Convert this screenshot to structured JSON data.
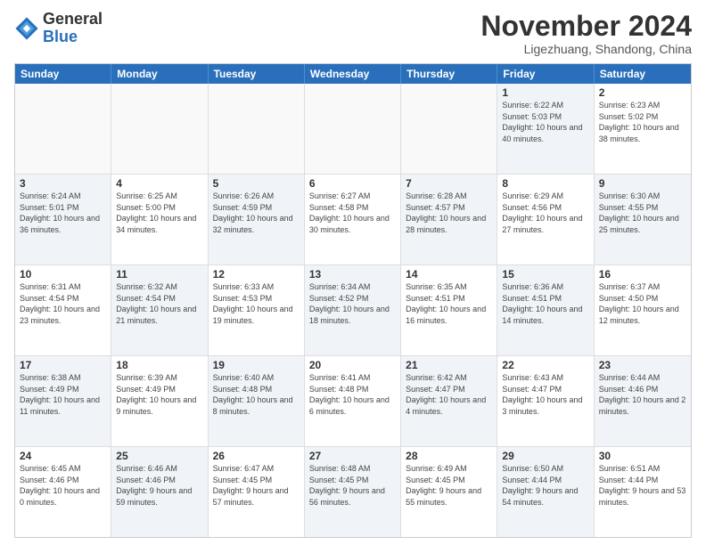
{
  "logo": {
    "general": "General",
    "blue": "Blue"
  },
  "title": "November 2024",
  "location": "Ligezhuang, Shandong, China",
  "headers": [
    "Sunday",
    "Monday",
    "Tuesday",
    "Wednesday",
    "Thursday",
    "Friday",
    "Saturday"
  ],
  "rows": [
    [
      {
        "num": "",
        "info": "",
        "empty": true
      },
      {
        "num": "",
        "info": "",
        "empty": true
      },
      {
        "num": "",
        "info": "",
        "empty": true
      },
      {
        "num": "",
        "info": "",
        "empty": true
      },
      {
        "num": "",
        "info": "",
        "empty": true
      },
      {
        "num": "1",
        "info": "Sunrise: 6:22 AM\nSunset: 5:03 PM\nDaylight: 10 hours and 40 minutes.",
        "shaded": true
      },
      {
        "num": "2",
        "info": "Sunrise: 6:23 AM\nSunset: 5:02 PM\nDaylight: 10 hours and 38 minutes.",
        "shaded": false
      }
    ],
    [
      {
        "num": "3",
        "info": "Sunrise: 6:24 AM\nSunset: 5:01 PM\nDaylight: 10 hours and 36 minutes.",
        "shaded": true
      },
      {
        "num": "4",
        "info": "Sunrise: 6:25 AM\nSunset: 5:00 PM\nDaylight: 10 hours and 34 minutes.",
        "shaded": false
      },
      {
        "num": "5",
        "info": "Sunrise: 6:26 AM\nSunset: 4:59 PM\nDaylight: 10 hours and 32 minutes.",
        "shaded": true
      },
      {
        "num": "6",
        "info": "Sunrise: 6:27 AM\nSunset: 4:58 PM\nDaylight: 10 hours and 30 minutes.",
        "shaded": false
      },
      {
        "num": "7",
        "info": "Sunrise: 6:28 AM\nSunset: 4:57 PM\nDaylight: 10 hours and 28 minutes.",
        "shaded": true
      },
      {
        "num": "8",
        "info": "Sunrise: 6:29 AM\nSunset: 4:56 PM\nDaylight: 10 hours and 27 minutes.",
        "shaded": false
      },
      {
        "num": "9",
        "info": "Sunrise: 6:30 AM\nSunset: 4:55 PM\nDaylight: 10 hours and 25 minutes.",
        "shaded": true
      }
    ],
    [
      {
        "num": "10",
        "info": "Sunrise: 6:31 AM\nSunset: 4:54 PM\nDaylight: 10 hours and 23 minutes.",
        "shaded": false
      },
      {
        "num": "11",
        "info": "Sunrise: 6:32 AM\nSunset: 4:54 PM\nDaylight: 10 hours and 21 minutes.",
        "shaded": true
      },
      {
        "num": "12",
        "info": "Sunrise: 6:33 AM\nSunset: 4:53 PM\nDaylight: 10 hours and 19 minutes.",
        "shaded": false
      },
      {
        "num": "13",
        "info": "Sunrise: 6:34 AM\nSunset: 4:52 PM\nDaylight: 10 hours and 18 minutes.",
        "shaded": true
      },
      {
        "num": "14",
        "info": "Sunrise: 6:35 AM\nSunset: 4:51 PM\nDaylight: 10 hours and 16 minutes.",
        "shaded": false
      },
      {
        "num": "15",
        "info": "Sunrise: 6:36 AM\nSunset: 4:51 PM\nDaylight: 10 hours and 14 minutes.",
        "shaded": true
      },
      {
        "num": "16",
        "info": "Sunrise: 6:37 AM\nSunset: 4:50 PM\nDaylight: 10 hours and 12 minutes.",
        "shaded": false
      }
    ],
    [
      {
        "num": "17",
        "info": "Sunrise: 6:38 AM\nSunset: 4:49 PM\nDaylight: 10 hours and 11 minutes.",
        "shaded": true
      },
      {
        "num": "18",
        "info": "Sunrise: 6:39 AM\nSunset: 4:49 PM\nDaylight: 10 hours and 9 minutes.",
        "shaded": false
      },
      {
        "num": "19",
        "info": "Sunrise: 6:40 AM\nSunset: 4:48 PM\nDaylight: 10 hours and 8 minutes.",
        "shaded": true
      },
      {
        "num": "20",
        "info": "Sunrise: 6:41 AM\nSunset: 4:48 PM\nDaylight: 10 hours and 6 minutes.",
        "shaded": false
      },
      {
        "num": "21",
        "info": "Sunrise: 6:42 AM\nSunset: 4:47 PM\nDaylight: 10 hours and 4 minutes.",
        "shaded": true
      },
      {
        "num": "22",
        "info": "Sunrise: 6:43 AM\nSunset: 4:47 PM\nDaylight: 10 hours and 3 minutes.",
        "shaded": false
      },
      {
        "num": "23",
        "info": "Sunrise: 6:44 AM\nSunset: 4:46 PM\nDaylight: 10 hours and 2 minutes.",
        "shaded": true
      }
    ],
    [
      {
        "num": "24",
        "info": "Sunrise: 6:45 AM\nSunset: 4:46 PM\nDaylight: 10 hours and 0 minutes.",
        "shaded": false
      },
      {
        "num": "25",
        "info": "Sunrise: 6:46 AM\nSunset: 4:46 PM\nDaylight: 9 hours and 59 minutes.",
        "shaded": true
      },
      {
        "num": "26",
        "info": "Sunrise: 6:47 AM\nSunset: 4:45 PM\nDaylight: 9 hours and 57 minutes.",
        "shaded": false
      },
      {
        "num": "27",
        "info": "Sunrise: 6:48 AM\nSunset: 4:45 PM\nDaylight: 9 hours and 56 minutes.",
        "shaded": true
      },
      {
        "num": "28",
        "info": "Sunrise: 6:49 AM\nSunset: 4:45 PM\nDaylight: 9 hours and 55 minutes.",
        "shaded": false
      },
      {
        "num": "29",
        "info": "Sunrise: 6:50 AM\nSunset: 4:44 PM\nDaylight: 9 hours and 54 minutes.",
        "shaded": true
      },
      {
        "num": "30",
        "info": "Sunrise: 6:51 AM\nSunset: 4:44 PM\nDaylight: 9 hours and 53 minutes.",
        "shaded": false
      }
    ]
  ]
}
